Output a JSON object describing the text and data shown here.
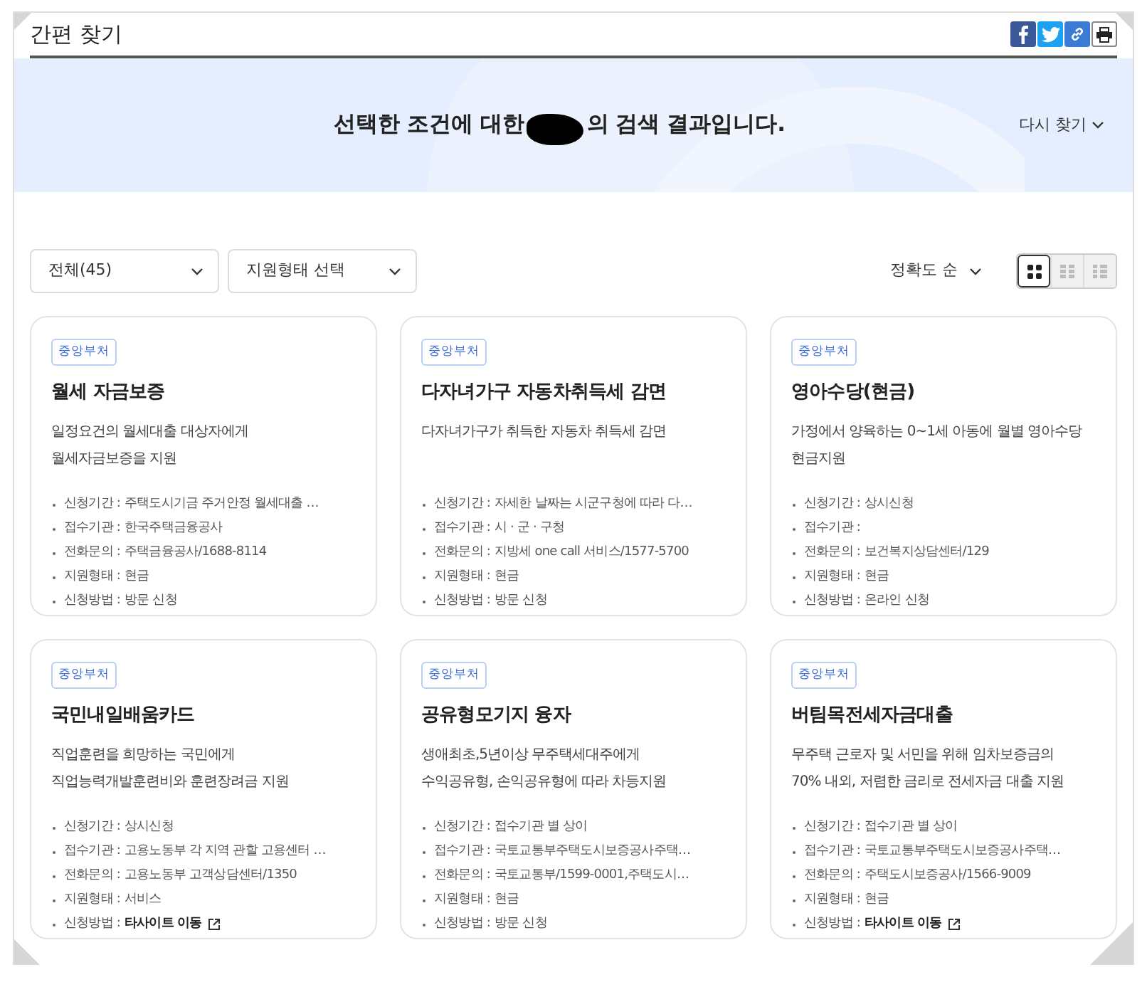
{
  "page_title": "간편 찾기",
  "share_buttons": [
    {
      "kind": "facebook"
    },
    {
      "kind": "twitter"
    },
    {
      "kind": "link"
    },
    {
      "kind": "print"
    }
  ],
  "banner": {
    "text_before": "선택한 조건에 대한",
    "text_after": "의 검색 결과입니다.",
    "redacted": true,
    "search_again": "다시 찾기"
  },
  "filters": [
    {
      "value": "전체(45)"
    },
    {
      "value": "지원형태 선택"
    }
  ],
  "sort": {
    "value": "정확도 순"
  },
  "view_modes": [
    {
      "kind": "grid",
      "selected": true
    },
    {
      "kind": "list",
      "selected": false
    },
    {
      "kind": "detail",
      "selected": false
    }
  ],
  "cards": [
    {
      "tag": "중앙부처",
      "title": "월세 자금보증",
      "description": [
        "일정요건의 월세대출 대상자에게",
        "월세자금보증을 지원"
      ],
      "details": [
        {
          "label": "신청기간 :",
          "value": "주택도시기금 주거안정 월세대출 …",
          "kind": "text"
        },
        {
          "label": "접수기관 :",
          "value": "한국주택금융공사",
          "kind": "text"
        },
        {
          "label": "전화문의 :",
          "value": "주택금융공사/1688-8114",
          "kind": "text"
        },
        {
          "label": "지원형태 :",
          "value": "현금",
          "kind": "text"
        },
        {
          "label": "신청방법 :",
          "value": "방문 신청",
          "kind": "text"
        }
      ]
    },
    {
      "tag": "중앙부처",
      "title": "다자녀가구 자동차취득세 감면",
      "description": [
        "다자녀가구가 취득한 자동차 취득세 감면"
      ],
      "details": [
        {
          "label": "신청기간 :",
          "value": "자세한 날짜는 시군구청에 따라 다…",
          "kind": "text"
        },
        {
          "label": "접수기관 :",
          "value": "시 · 군 · 구청",
          "kind": "text"
        },
        {
          "label": "전화문의 :",
          "value": "지방세 one call 서비스/1577-5700",
          "kind": "text"
        },
        {
          "label": "지원형태 :",
          "value": "현금",
          "kind": "text"
        },
        {
          "label": "신청방법 :",
          "value": "방문 신청",
          "kind": "text"
        }
      ]
    },
    {
      "tag": "중앙부처",
      "title": "영아수당(현금)",
      "description": [
        "가정에서 양육하는 0~1세 아동에 월별 영아수당",
        "현금지원"
      ],
      "details": [
        {
          "label": "신청기간 :",
          "value": "상시신청",
          "kind": "text"
        },
        {
          "label": "접수기관 :",
          "kind": "text"
        },
        {
          "label": "전화문의 :",
          "value": "보건복지상담센터/129",
          "kind": "text"
        },
        {
          "label": "지원형태 :",
          "value": "현금",
          "kind": "text"
        },
        {
          "label": "신청방법 :",
          "value": "온라인 신청",
          "kind": "text"
        }
      ]
    },
    {
      "tag": "중앙부처",
      "title": "국민내일배움카드",
      "description": [
        "직업훈련을 희망하는 국민에게",
        "직업능력개발훈련비와 훈련장려금 지원"
      ],
      "details": [
        {
          "label": "신청기간 :",
          "value": "상시신청",
          "kind": "text"
        },
        {
          "label": "접수기관 :",
          "value": "고용노동부 각 지역 관할 고용센터 …",
          "kind": "text"
        },
        {
          "label": "전화문의 :",
          "value": "고용노동부 고객상담센터/1350",
          "kind": "text"
        },
        {
          "label": "지원형태 :",
          "value": "서비스",
          "kind": "text"
        },
        {
          "label": "신청방법 :",
          "value": "타사이트 이동",
          "kind": "link"
        }
      ]
    },
    {
      "tag": "중앙부처",
      "title": "공유형모기지 융자",
      "description": [
        "생애최초,5년이상 무주택세대주에게",
        "수익공유형, 손익공유형에 따라 차등지원"
      ],
      "details": [
        {
          "label": "신청기간 :",
          "value": "접수기관 별 상이",
          "kind": "text"
        },
        {
          "label": "접수기관 :",
          "value": "국토교통부주택도시보증공사주택…",
          "kind": "text"
        },
        {
          "label": "전화문의 :",
          "value": "국토교통부/1599-0001,주택도시…",
          "kind": "text"
        },
        {
          "label": "지원형태 :",
          "value": "현금",
          "kind": "text"
        },
        {
          "label": "신청방법 :",
          "value": "방문 신청",
          "kind": "text"
        }
      ]
    },
    {
      "tag": "중앙부처",
      "title": "버팀목전세자금대출",
      "description": [
        "무주택 근로자 및 서민을 위해 임차보증금의",
        "70% 내외, 저렴한 금리로 전세자금 대출 지원"
      ],
      "details": [
        {
          "label": "신청기간 :",
          "value": "접수기관 별 상이",
          "kind": "text"
        },
        {
          "label": "접수기관 :",
          "value": "국토교통부주택도시보증공사주택…",
          "kind": "text"
        },
        {
          "label": "전화문의 :",
          "value": "주택도시보증공사/1566-9009",
          "kind": "text"
        },
        {
          "label": "지원형태 :",
          "value": "현금",
          "kind": "text"
        },
        {
          "label": "신청방법 :",
          "value": "타사이트 이동",
          "kind": "link"
        }
      ]
    }
  ]
}
